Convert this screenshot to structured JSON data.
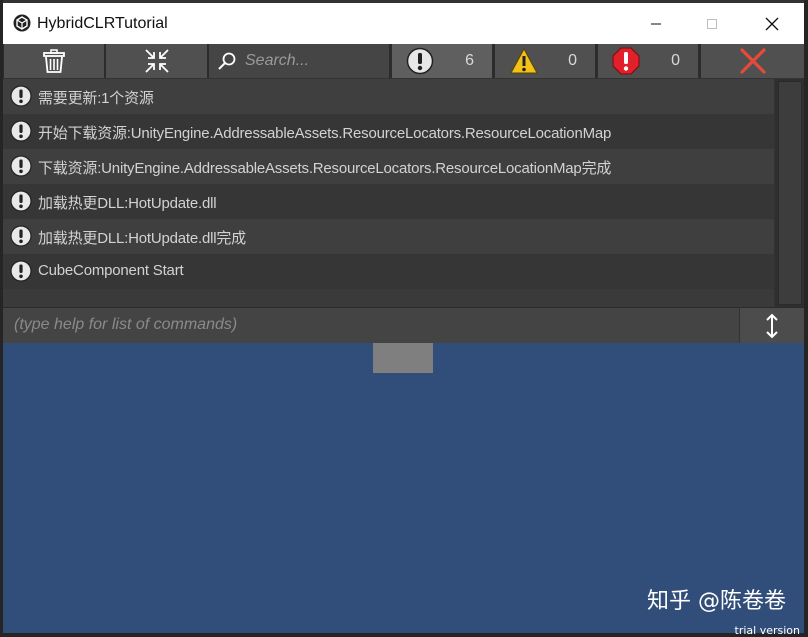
{
  "window": {
    "title": "HybridCLRTutorial"
  },
  "toolbar": {
    "search_placeholder": "Search...",
    "info_count": "6",
    "warning_count": "0",
    "error_count": "0"
  },
  "log": {
    "entries": [
      "需要更新:1个资源",
      "开始下载资源:UnityEngine.AddressableAssets.ResourceLocators.ResourceLocationMap",
      "下载资源:UnityEngine.AddressableAssets.ResourceLocators.ResourceLocationMap完成",
      "加载热更DLL:HotUpdate.dll",
      "加载热更DLL:HotUpdate.dll完成",
      "CubeComponent Start"
    ]
  },
  "command": {
    "placeholder": "(type help for list of commands)"
  },
  "overlay": {
    "watermark": "知乎 @陈卷卷",
    "trial": "trial version"
  },
  "colors": {
    "game_background": "#314d79",
    "info_icon": "#e8e8e8",
    "warning_icon": "#f2c21b",
    "error_icon": "#e0202a",
    "clear_icon": "#e84a3a"
  }
}
